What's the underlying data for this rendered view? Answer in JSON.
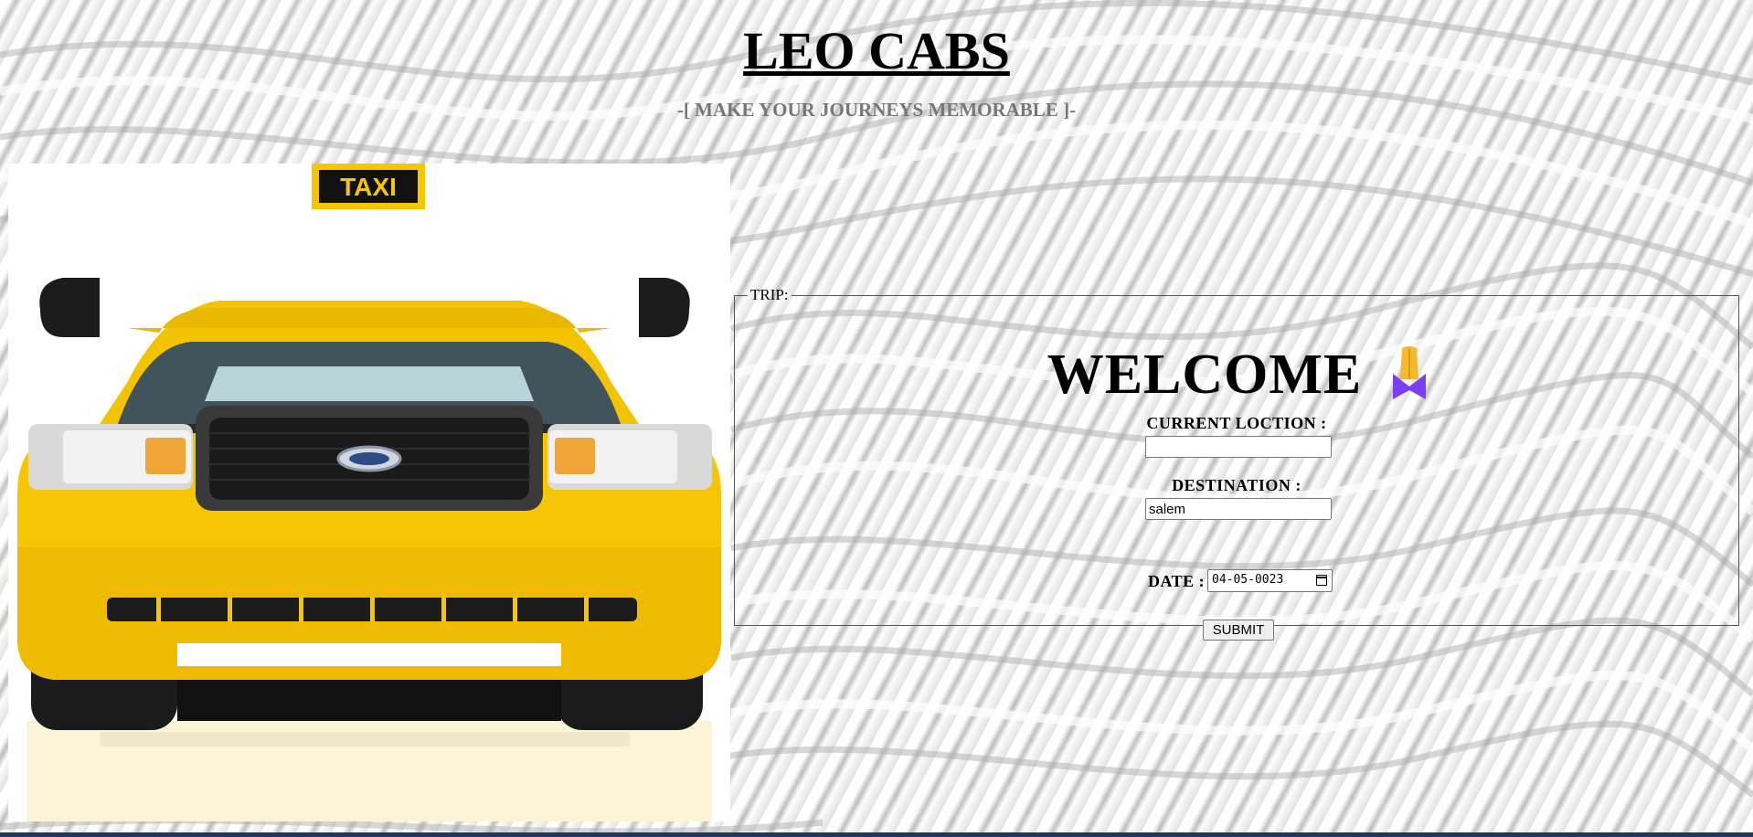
{
  "header": {
    "title": "LEO CABS",
    "tagline": "-[ MAKE YOUR JOURNEYS MEMORABLE ]-"
  },
  "hero_image": {
    "taxi_sign": "TAXI"
  },
  "trip_form": {
    "legend": "TRIP:",
    "welcome": "WELCOME",
    "current_location_label": "CURRENT LOCTION :",
    "current_location_value": "",
    "destination_label": "DESTINATION :",
    "destination_value": "salem",
    "date_label": "DATE :",
    "date_value": "04-05-0023",
    "submit_label": "SUBMIT"
  },
  "icons": {
    "welcome_icon": "folded-hands-icon",
    "date_icon": "calendar-icon"
  },
  "colors": {
    "taxi_yellow": "#f5c400",
    "accent_purple": "#7b3ff2",
    "bottom_bar": "#1c3562"
  }
}
